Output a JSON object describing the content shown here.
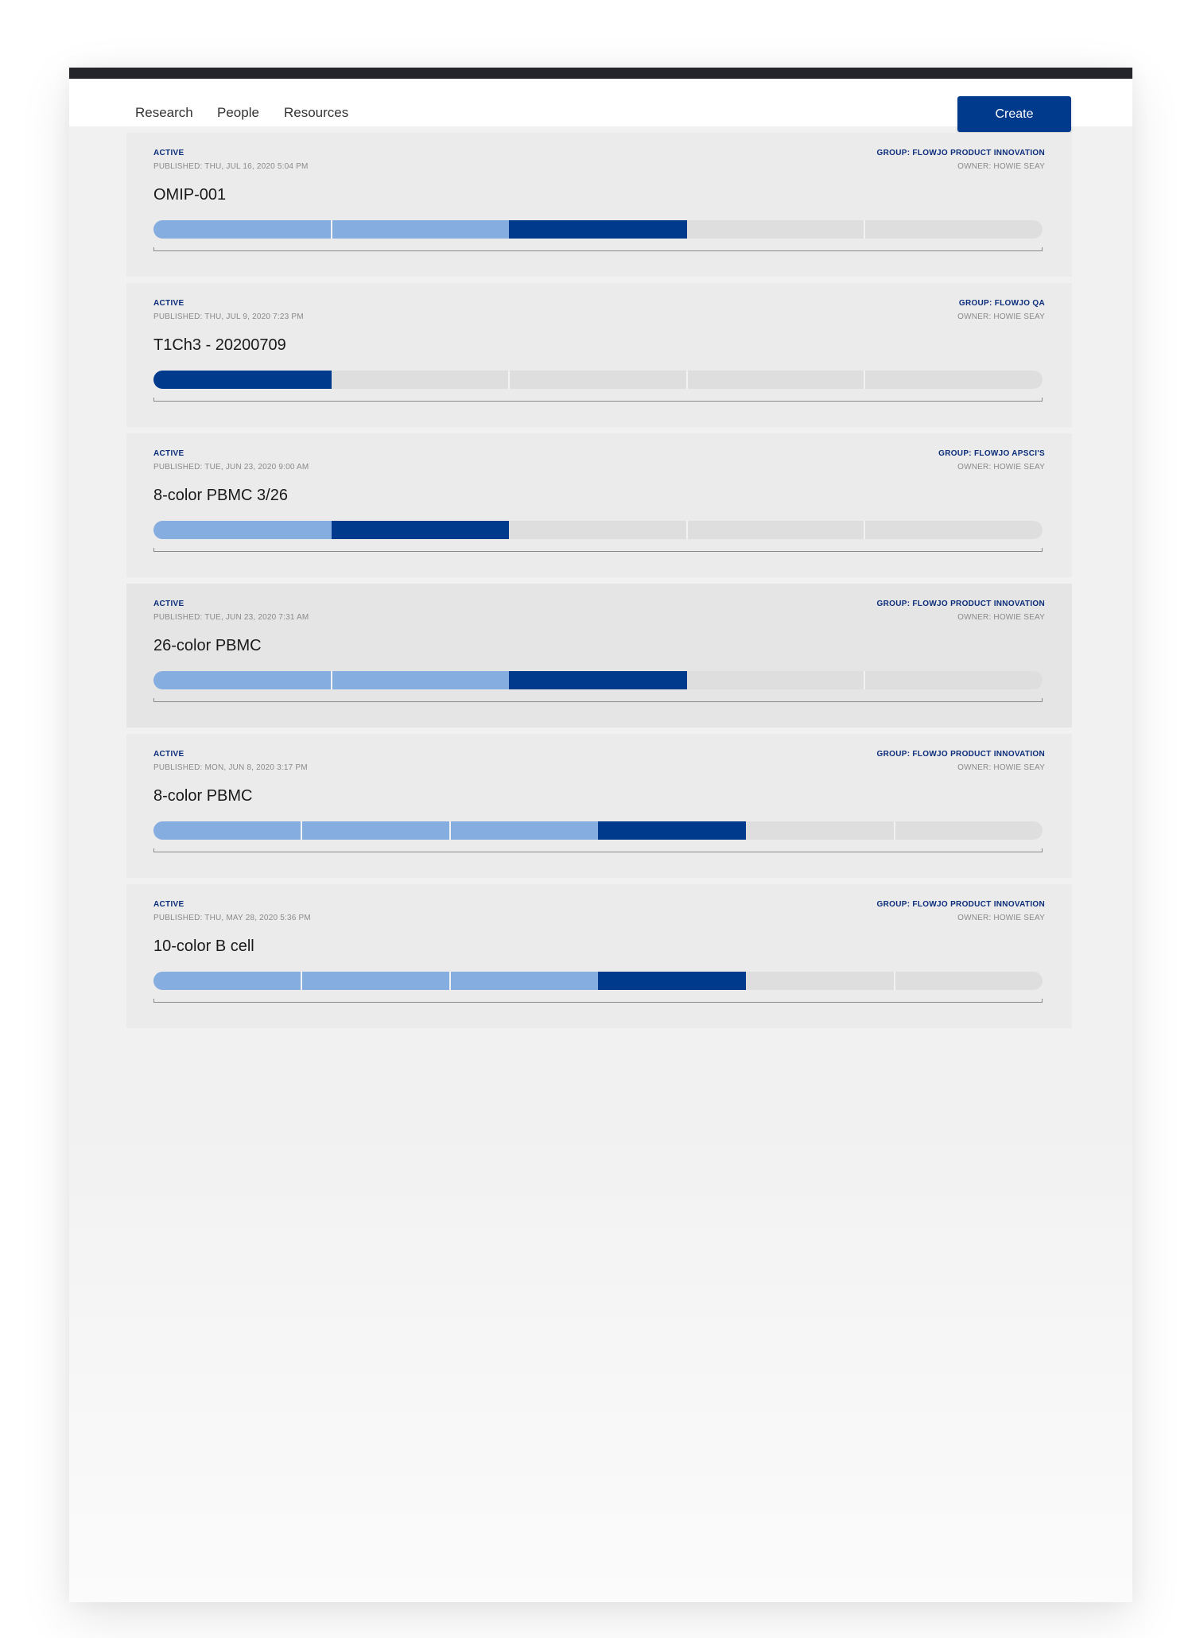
{
  "nav": {
    "items": [
      "Research",
      "People",
      "Resources"
    ],
    "create_label": "Create"
  },
  "colors": {
    "brand": "#003a8c",
    "completed_step": "#85ade0",
    "pending_step": "#dedede",
    "status_text": "#0b2d7a"
  },
  "experiments": [
    {
      "status": "ACTIVE",
      "published": "PUBLISHED: THU, JUL 16, 2020 5:04 PM",
      "group": "GROUP: FLOWJO PRODUCT INNOVATION",
      "owner": "OWNER: HOWIE SEAY",
      "title": "OMIP-001",
      "progress": {
        "total_steps": 5,
        "completed_steps": 2,
        "current_step": 3
      }
    },
    {
      "status": "ACTIVE",
      "published": "PUBLISHED: THU, JUL 9, 2020 7:23 PM",
      "group": "GROUP: FLOWJO QA",
      "owner": "OWNER: HOWIE SEAY",
      "title": "T1Ch3 - 20200709",
      "progress": {
        "total_steps": 5,
        "completed_steps": 0,
        "current_step": 1
      }
    },
    {
      "status": "ACTIVE",
      "published": "PUBLISHED: TUE, JUN 23, 2020 9:00 AM",
      "group": "GROUP: FLOWJO APSCI'S",
      "owner": "OWNER: HOWIE SEAY",
      "title": "8-color PBMC 3/26",
      "progress": {
        "total_steps": 5,
        "completed_steps": 1,
        "current_step": 2
      }
    },
    {
      "status": "ACTIVE",
      "published": "PUBLISHED: TUE, JUN 23, 2020 7:31 AM",
      "group": "GROUP: FLOWJO PRODUCT INNOVATION",
      "owner": "OWNER: HOWIE SEAY",
      "title": "26-color PBMC",
      "progress": {
        "total_steps": 5,
        "completed_steps": 2,
        "current_step": 3
      }
    },
    {
      "status": "ACTIVE",
      "published": "PUBLISHED: MON, JUN 8, 2020 3:17 PM",
      "group": "GROUP: FLOWJO PRODUCT INNOVATION",
      "owner": "OWNER: HOWIE SEAY",
      "title": "8-color PBMC",
      "progress": {
        "total_steps": 6,
        "completed_steps": 3,
        "current_step": 4
      }
    },
    {
      "status": "ACTIVE",
      "published": "PUBLISHED: THU, MAY 28, 2020 5:36 PM",
      "group": "GROUP: FLOWJO PRODUCT INNOVATION",
      "owner": "OWNER: HOWIE SEAY",
      "title": "10-color B cell",
      "progress": {
        "total_steps": 6,
        "completed_steps": 3,
        "current_step": 4
      }
    }
  ]
}
